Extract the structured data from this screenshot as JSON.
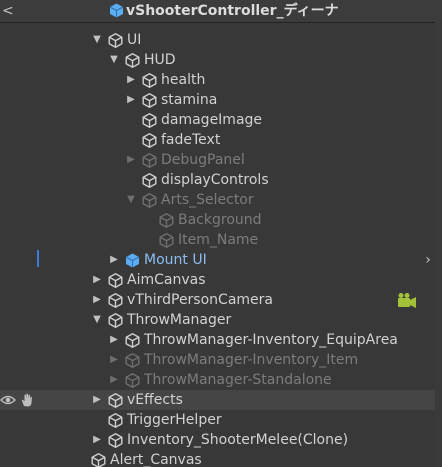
{
  "window": {
    "title": "vShooterController_ディーナ",
    "back_glyph": "<"
  },
  "hierarchy": [
    {
      "label": "UI",
      "depth": 0,
      "toggle": "expanded",
      "style": "normal"
    },
    {
      "label": "HUD",
      "depth": 1,
      "toggle": "expanded",
      "style": "normal"
    },
    {
      "label": "health",
      "depth": 2,
      "toggle": "collapsed",
      "style": "normal"
    },
    {
      "label": "stamina",
      "depth": 2,
      "toggle": "collapsed",
      "style": "normal"
    },
    {
      "label": "damageImage",
      "depth": 2,
      "toggle": "none",
      "style": "normal"
    },
    {
      "label": "fadeText",
      "depth": 2,
      "toggle": "none",
      "style": "normal"
    },
    {
      "label": "DebugPanel",
      "depth": 2,
      "toggle": "collapsed",
      "style": "dim"
    },
    {
      "label": "displayControls",
      "depth": 2,
      "toggle": "none",
      "style": "normal"
    },
    {
      "label": "Arts_Selector",
      "depth": 2,
      "toggle": "expanded",
      "style": "dim"
    },
    {
      "label": "Background",
      "depth": 3,
      "toggle": "none",
      "style": "dim"
    },
    {
      "label": "Item_Name",
      "depth": 3,
      "toggle": "none",
      "style": "dim"
    },
    {
      "label": "Mount UI",
      "depth": 1,
      "toggle": "collapsed",
      "style": "prefab",
      "has_chevron": true
    },
    {
      "label": "AimCanvas",
      "depth": 0,
      "toggle": "collapsed",
      "style": "normal"
    },
    {
      "label": "vThirdPersonCamera",
      "depth": 0,
      "toggle": "collapsed",
      "style": "normal",
      "has_camera_icon": true
    },
    {
      "label": "ThrowManager",
      "depth": 0,
      "toggle": "expanded",
      "style": "normal"
    },
    {
      "label": "ThrowManager-Inventory_EquipArea",
      "depth": 1,
      "toggle": "collapsed",
      "style": "normal"
    },
    {
      "label": "ThrowManager-Inventory_Item",
      "depth": 1,
      "toggle": "collapsed",
      "style": "dim"
    },
    {
      "label": "ThrowManager-Standalone",
      "depth": 1,
      "toggle": "collapsed",
      "style": "dim"
    },
    {
      "label": "vEffects",
      "depth": 0,
      "toggle": "collapsed",
      "style": "normal",
      "hover": true
    },
    {
      "label": "TriggerHelper",
      "depth": 0,
      "toggle": "none",
      "style": "normal"
    },
    {
      "label": "Inventory_ShooterMelee(Clone)",
      "depth": 0,
      "toggle": "collapsed",
      "style": "normal"
    },
    {
      "label": "Alert_Canvas",
      "depth": -1,
      "toggle": "none",
      "style": "normal"
    }
  ],
  "colors": {
    "background": "#383838",
    "text": "#d2d2d2",
    "text_dim": "#7c7c7c",
    "prefab_text": "#8cbcf2",
    "prefab_cube": "#5cacf0",
    "hover_row": "#454545",
    "selection_marker": "#3d7bd6",
    "camera_icon": "#a3c23a"
  },
  "icons": {
    "game_object": "cube-outline-icon",
    "prefab": "prefab-cube-icon",
    "expanded": "triangle-down-icon",
    "collapsed": "triangle-right-icon",
    "camera": "camera-icon",
    "visibility": "eye-icon",
    "pickability": "hand-icon",
    "open_prefab": "chevron-right-icon"
  }
}
